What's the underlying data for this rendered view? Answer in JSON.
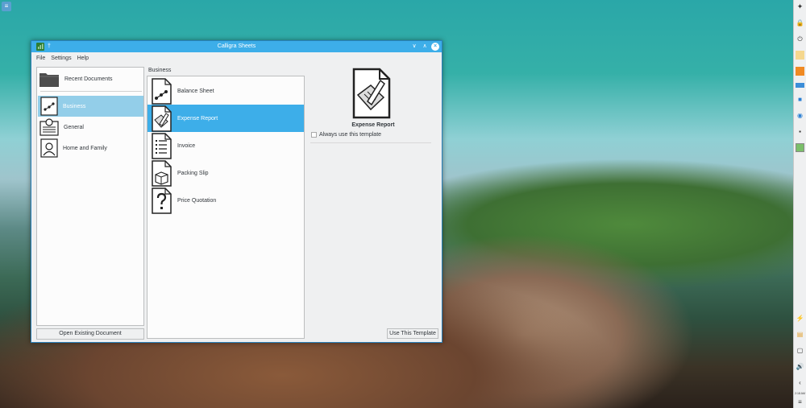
{
  "window": {
    "title": "Calligra Sheets",
    "pin_glyph": "†",
    "minimize_glyph": "∨",
    "maximize_glyph": "∧",
    "close_glyph": "×"
  },
  "menubar": {
    "items": [
      "File",
      "Settings",
      "Help"
    ]
  },
  "categories": {
    "items": [
      {
        "label": "Recent Documents",
        "icon": "folder-icon"
      },
      {
        "label": "Business",
        "icon": "business-template-icon",
        "selected": true
      },
      {
        "label": "General",
        "icon": "general-template-icon"
      },
      {
        "label": "Home and Family",
        "icon": "home-family-template-icon"
      }
    ],
    "open_button_label": "Open Existing Document"
  },
  "templates": {
    "header": "Business",
    "items": [
      {
        "label": "Balance Sheet",
        "icon": "balance-sheet-icon"
      },
      {
        "label": "Expense Report",
        "icon": "expense-report-icon",
        "selected": true
      },
      {
        "label": "Invoice",
        "icon": "invoice-icon"
      },
      {
        "label": "Packing Slip",
        "icon": "packing-slip-icon"
      },
      {
        "label": "Price Quotation",
        "icon": "price-quotation-icon"
      }
    ]
  },
  "preview": {
    "title": "Expense Report",
    "always_use_label": "Always use this template",
    "always_use_checked": false,
    "use_button_label": "Use This Template"
  },
  "desktop": {
    "menu_button_glyph": "≡",
    "tray_icons": [
      "🔒",
      "⏻",
      "▤",
      "▦",
      "▬",
      "■",
      "◉",
      "▪",
      "▣"
    ],
    "tray_icons_bottom": [
      "⚡",
      "▤",
      "▢",
      "🔊",
      "‹",
      "≡"
    ],
    "clock_text": "2:18 AM"
  },
  "colors": {
    "accent": "#3daee9",
    "selection_light": "#93cee9",
    "window_bg": "#eff0f1"
  }
}
